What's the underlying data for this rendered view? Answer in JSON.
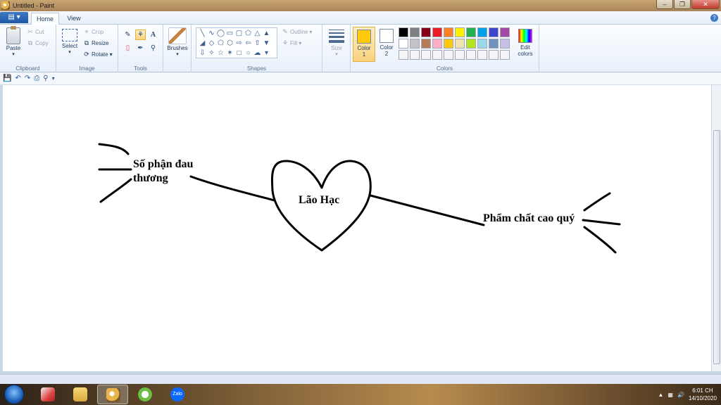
{
  "window": {
    "title": "Untitled - Paint"
  },
  "tabs": {
    "home": "Home",
    "view": "View"
  },
  "clipboard": {
    "paste": "Paste",
    "cut": "Cut",
    "copy": "Copy",
    "group": "Clipboard"
  },
  "image": {
    "select": "Select",
    "crop": "Crop",
    "resize": "Resize",
    "rotate": "Rotate",
    "group": "Image"
  },
  "tools": {
    "group": "Tools",
    "text_tool": "A"
  },
  "brushes": {
    "label": "Brushes"
  },
  "shapes": {
    "outline": "Outline",
    "fill": "Fill",
    "group": "Shapes"
  },
  "size": {
    "label": "Size"
  },
  "colors": {
    "color1_label": "Color",
    "color1_num": "1",
    "color2_label": "Color",
    "color2_num": "2",
    "edit_label": "Edit",
    "edit_label2": "colors",
    "group": "Colors",
    "color1_value": "#ffc90e",
    "color2_value": "#ffffff",
    "row1": [
      "#000000",
      "#7f7f7f",
      "#880015",
      "#ed1c24",
      "#ff7f27",
      "#fff200",
      "#22b14c",
      "#00a2e8",
      "#3f48cc",
      "#a349a4"
    ],
    "row2": [
      "#ffffff",
      "#c3c3c3",
      "#b97a57",
      "#ffaec9",
      "#ffc90e",
      "#efe4b0",
      "#b5e61d",
      "#99d9ea",
      "#7092be",
      "#c8bfe7"
    ],
    "row3": [
      "#f5f5f5",
      "#f5f5f5",
      "#f5f5f5",
      "#f5f5f5",
      "#f5f5f5",
      "#f5f5f5",
      "#f5f5f5",
      "#f5f5f5",
      "#f5f5f5",
      "#f5f5f5"
    ]
  },
  "canvas": {
    "left_label_line1": "Số phận đau",
    "left_label_line2": "thương",
    "center_label": "Lão Hạc",
    "right_label": "Phẩm chất cao quý"
  },
  "taskbar": {
    "zalo": "Zalo",
    "time": "6:01 CH",
    "date": "14/10/2020"
  }
}
